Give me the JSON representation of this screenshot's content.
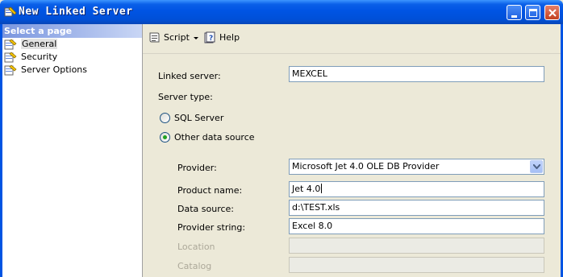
{
  "window": {
    "title": "New Linked Server"
  },
  "sidebar": {
    "header": "Select a page",
    "items": [
      {
        "label": "General",
        "selected": true
      },
      {
        "label": "Security",
        "selected": false
      },
      {
        "label": "Server Options",
        "selected": false
      }
    ]
  },
  "toolbar": {
    "script_label": "Script",
    "help_label": "Help"
  },
  "form": {
    "linked_server_label": "Linked server:",
    "linked_server_value": "MEXCEL",
    "server_type_label": "Server type:",
    "radio_sql_label": "SQL Server",
    "radio_other_label": "Other data source",
    "server_type_selected": "Other data source",
    "provider_label": "Provider:",
    "provider_value": "Microsoft Jet 4.0 OLE DB Provider",
    "product_name_label": "Product name:",
    "product_name_value": "Jet 4.0",
    "data_source_label": "Data source:",
    "data_source_value": "d:\\TEST.xls",
    "provider_string_label": "Provider string:",
    "provider_string_value": "Excel 8.0",
    "location_label": "Location",
    "location_value": "",
    "catalog_label": "Catalog",
    "catalog_value": ""
  },
  "colors": {
    "titlebar": "#0054e3",
    "window_bg": "#ece9d8",
    "radio_dot": "#21a121"
  }
}
